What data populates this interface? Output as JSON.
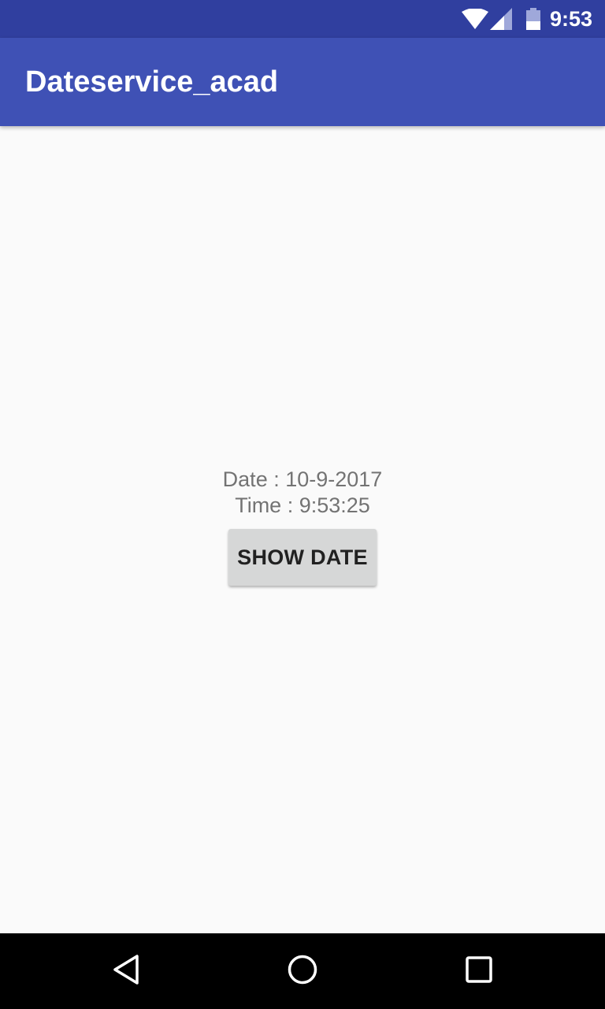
{
  "status_bar": {
    "time": "9:53",
    "icons": [
      "wifi-icon",
      "signal-icon",
      "battery-icon"
    ],
    "color": "#303f9f"
  },
  "app_bar": {
    "title": "Dateservice_acad",
    "color": "#3f51b5"
  },
  "main": {
    "date_text": "Date : 10-9-2017",
    "time_text": "Time : 9:53:25",
    "show_date_label": "SHOW DATE"
  },
  "nav_bar": {
    "icons": [
      "back-icon",
      "home-icon",
      "recents-icon"
    ]
  }
}
